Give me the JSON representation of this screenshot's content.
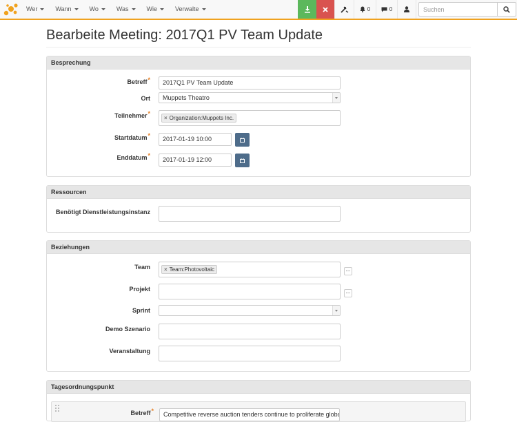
{
  "navbar": {
    "menu": [
      {
        "label": "Wer"
      },
      {
        "label": "Wann"
      },
      {
        "label": "Wo"
      },
      {
        "label": "Was"
      },
      {
        "label": "Wie"
      },
      {
        "label": "Verwalte"
      }
    ],
    "notifications_count": "0",
    "messages_count": "0",
    "search_placeholder": "Suchen",
    "colors": {
      "accent": "#f0a21f",
      "save": "#5cb85c",
      "cancel": "#d9534f"
    },
    "icons": [
      "logo-icon",
      "download-icon",
      "close-icon",
      "wrench-icon",
      "bell-icon",
      "comment-icon",
      "user-icon",
      "search-icon"
    ]
  },
  "page": {
    "title": "Bearbeite Meeting: 2017Q1 PV Team Update"
  },
  "besprechung": {
    "heading": "Besprechung",
    "betreff_label": "Betreff",
    "betreff_value": "2017Q1 PV Team Update",
    "ort_label": "Ort",
    "ort_value": "Muppets Theatro",
    "teilnehmer_label": "Teilnehmer",
    "teilnehmer_tag": "Organization:Muppets Inc.",
    "startdatum_label": "Startdatum",
    "startdatum_value": "2017-01-19 10:00",
    "enddatum_label": "Enddatum",
    "enddatum_value": "2017-01-19 12:00"
  },
  "ressourcen": {
    "heading": "Ressourcen",
    "dienstleistung_label": "Benötigt Dienstleistungsinstanz",
    "dienstleistung_value": ""
  },
  "beziehungen": {
    "heading": "Beziehungen",
    "team_label": "Team",
    "team_tag": "Team:Photovoltaic",
    "projekt_label": "Projekt",
    "projekt_value": "",
    "sprint_label": "Sprint",
    "sprint_value": "",
    "demo_label": "Demo Szenario",
    "demo_value": "",
    "veranstaltung_label": "Veranstaltung",
    "veranstaltung_value": ""
  },
  "tagesordnung": {
    "heading": "Tagesordnungspunkt",
    "betreff_label": "Betreff",
    "betreff_value": "Competitive reverse auction tenders continue to proliferate globally"
  },
  "common": {
    "tag_remove": "×",
    "more": "..."
  }
}
